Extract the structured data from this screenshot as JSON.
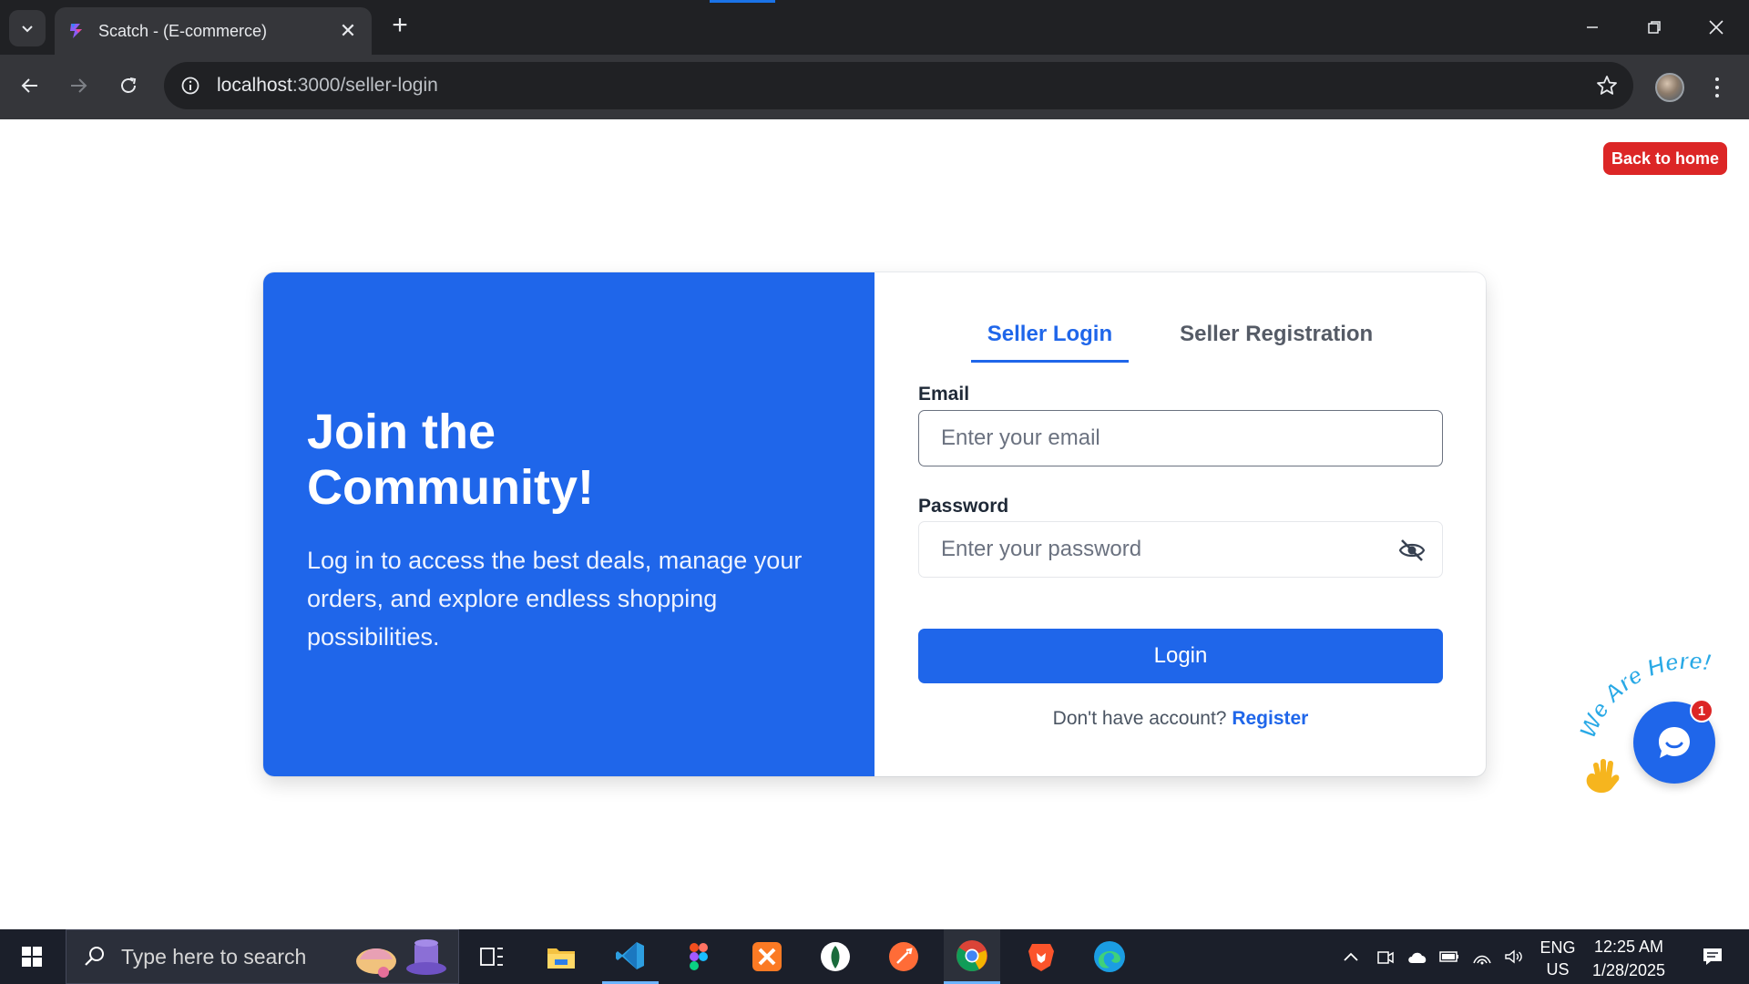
{
  "browser": {
    "tab_title": "Scatch - (E-commerce)",
    "tab_close": "✕",
    "new_tab": "+",
    "url_host": "localhost",
    "url_rest": ":3000/seller-login",
    "icons": [
      "tab-search-icon",
      "back-arrow-icon",
      "forward-arrow-icon",
      "reload-icon",
      "site-info-icon",
      "bookmark-star-icon",
      "profile-avatar",
      "menu-kebab-icon",
      "minimize-icon",
      "restore-icon",
      "close-icon"
    ]
  },
  "page": {
    "back_home": "Back to home",
    "hero": {
      "title": "Join the Community!",
      "subtitle": "Log in to access the best deals, manage your orders, and explore endless shopping possibilities."
    },
    "tabs": [
      {
        "label": "Seller Login",
        "active": true
      },
      {
        "label": "Seller Registration",
        "active": false
      }
    ],
    "form": {
      "email_label": "Email",
      "email_placeholder": "Enter your email",
      "password_label": "Password",
      "password_placeholder": "Enter your password",
      "login_button": "Login",
      "no_account_text": "Don't have account?",
      "register_link": "Register"
    },
    "chat_widget": {
      "banner": "We Are Here!",
      "badge_count": "1"
    },
    "colors": {
      "primary": "#1f66ea",
      "danger": "#dc2626"
    }
  },
  "taskbar": {
    "search_placeholder": "Type here to search",
    "apps": [
      "task-view",
      "file-explorer",
      "vscode",
      "figma",
      "xampp",
      "mongodb-compass",
      "postman",
      "chrome",
      "brave",
      "edge"
    ],
    "language_line1": "ENG",
    "language_line2": "US",
    "time": "12:25 AM",
    "date": "1/28/2025"
  }
}
